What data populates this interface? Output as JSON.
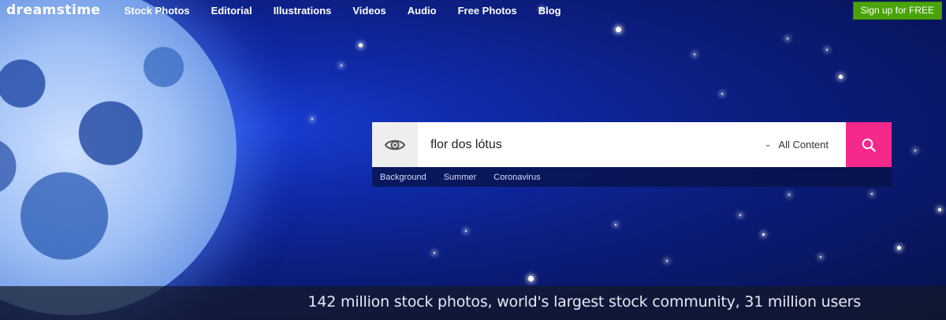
{
  "header": {
    "logo_text": "dreamstime",
    "nav": [
      {
        "label": "Stock Photos"
      },
      {
        "label": "Editorial"
      },
      {
        "label": "Illustrations"
      },
      {
        "label": "Videos"
      },
      {
        "label": "Audio"
      },
      {
        "label": "Free Photos"
      },
      {
        "label": "Blog"
      }
    ],
    "signup_label": "Sign up for FREE",
    "signup_color": "#4aa30a"
  },
  "search": {
    "eye_icon": "eye-icon",
    "query": "flor dos lótus",
    "content_filter": "All Content",
    "search_icon": "search-icon",
    "search_button_color": "#f5288b"
  },
  "suggestions": [
    "Background",
    "Summer",
    "Coronavirus"
  ],
  "footer": {
    "tagline": "142 million stock photos, world's largest stock community, 31 million users"
  }
}
